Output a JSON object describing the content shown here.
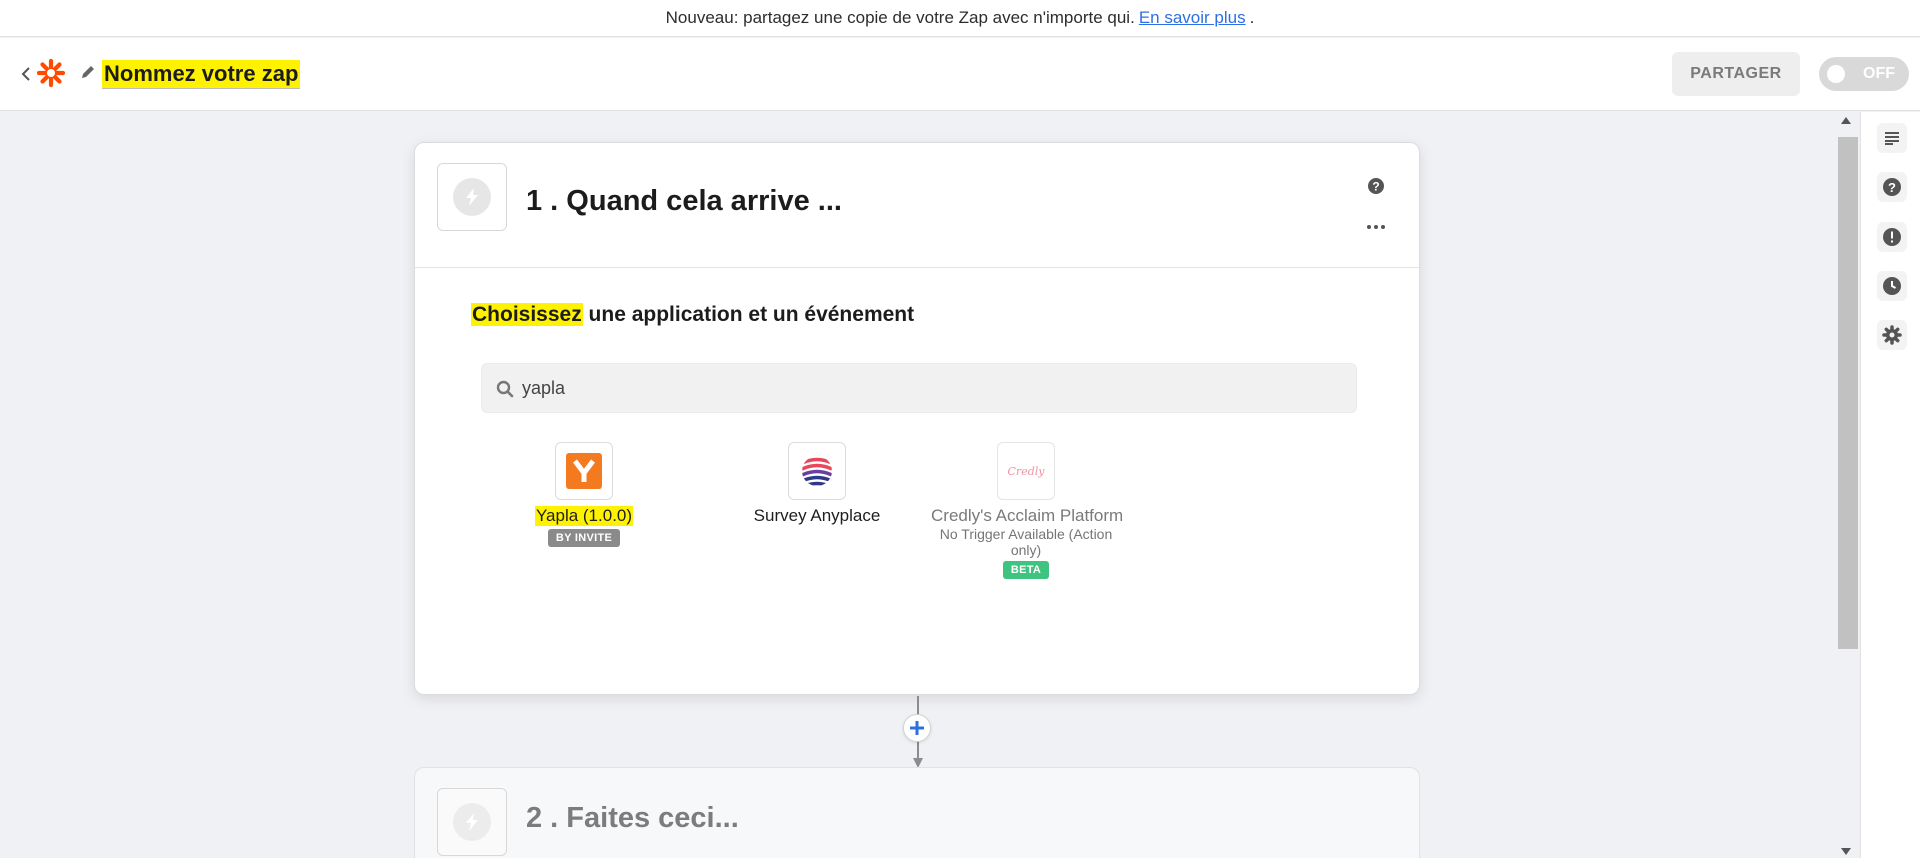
{
  "banner": {
    "text": "Nouveau: partagez une copie de votre Zap avec n'importe qui.",
    "link": "En savoir plus",
    "trailing": "."
  },
  "header": {
    "zap_name": "Nommez votre zap",
    "share_label": "PARTAGER",
    "toggle_label": "OFF",
    "logo_color": "#ff4a00"
  },
  "step1": {
    "title": "1 . Quand cela arrive ...",
    "choose_highlight": "Choisissez",
    "choose_rest": " une application et un événement",
    "search": {
      "value": "yapla"
    },
    "apps": [
      {
        "name": "Yapla (1.0.0)",
        "badge": "BY INVITE",
        "badge_color": "#8a8a8a",
        "icon_color": "#f47a20"
      },
      {
        "name": "Survey Anyplace"
      },
      {
        "name": "Credly's Acclaim Platform",
        "sub": "No Trigger Available (Action only)",
        "badge": "BETA",
        "badge_color": "#3fc380",
        "icon_text": "Credly"
      }
    ]
  },
  "step2": {
    "title": "2 . Faites ceci..."
  },
  "colors": {
    "highlight": "#fff200",
    "link": "#2f6fe4",
    "plus": "#2f6fe4"
  }
}
